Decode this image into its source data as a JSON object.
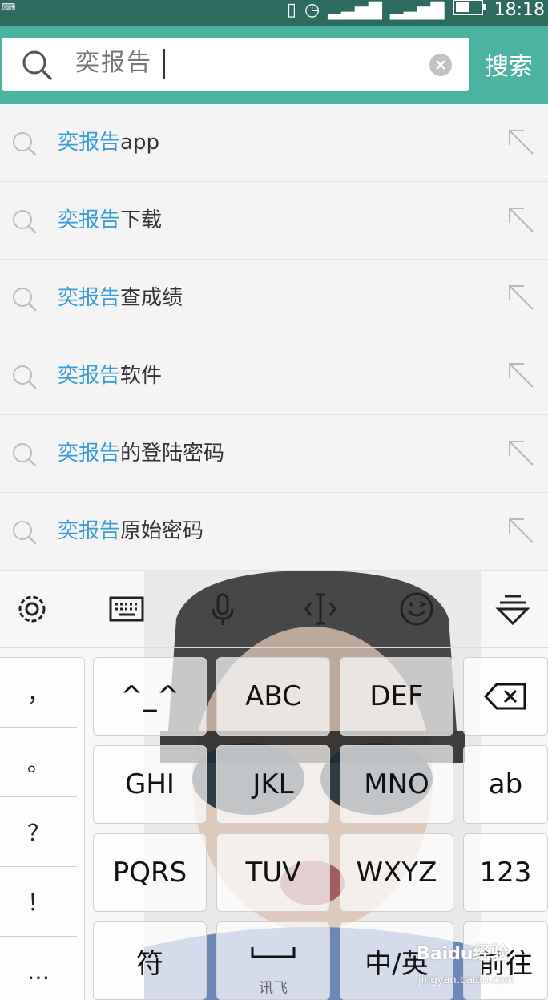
{
  "statusbar": {
    "time": "18:18",
    "icons": [
      "keyboard-icon",
      "vibrate-icon",
      "alarm-icon",
      "signal-icon",
      "signal-icon",
      "battery-icon"
    ]
  },
  "search": {
    "query": "奕报告",
    "submit_label": "搜索",
    "icons": [
      "search-icon",
      "clear-icon"
    ]
  },
  "suggestions": [
    {
      "keyword": "奕报告",
      "rest": "app"
    },
    {
      "keyword": "奕报告",
      "rest": "下载"
    },
    {
      "keyword": "奕报告",
      "rest": "查成绩"
    },
    {
      "keyword": "奕报告",
      "rest": "软件"
    },
    {
      "keyword": "奕报告",
      "rest": "的登陆密码"
    },
    {
      "keyword": "奕报告",
      "rest": "原始密码"
    }
  ],
  "keyboard": {
    "toolbar": [
      "settings-icon",
      "keyboard-icon",
      "microphone-icon",
      "cursor-icon",
      "emoji-icon",
      "collapse-icon"
    ],
    "symbols": [
      "，",
      "。",
      "？",
      "！",
      "…"
    ],
    "keys": {
      "emoticon": "^_^",
      "abc": "ABC",
      "def": "DEF",
      "ghi": "GHI",
      "jkl": "JKL",
      "mno": "MNO",
      "pqrs": "PQRS",
      "tuv": "TUV",
      "wxyz": "WXYZ",
      "ab": "ab",
      "num": "123",
      "fu": "符",
      "space_sub": "讯飞",
      "zh": "中/英",
      "go": "前往"
    }
  },
  "watermark": {
    "brand": "Baidu经验",
    "url": "jingyan.baidu.com"
  },
  "colors": {
    "header": "#4cb3a3",
    "statusbar": "#2d6b60",
    "keyword": "#3a9bd6"
  }
}
